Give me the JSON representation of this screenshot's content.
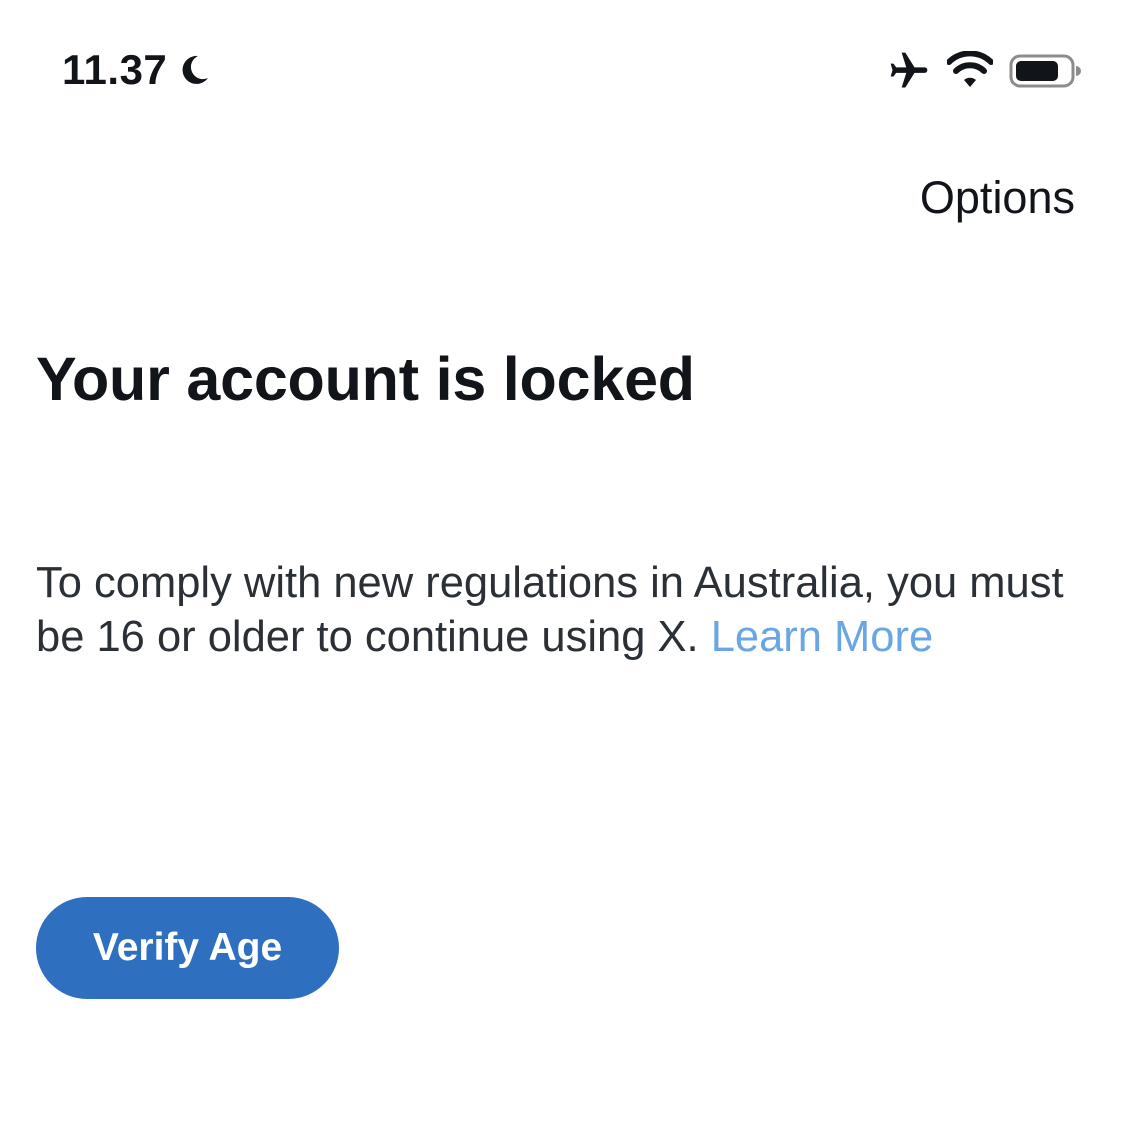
{
  "status_bar": {
    "time": "11.37",
    "focus_mode_icon": "moon-icon",
    "airplane_icon": "airplane-icon",
    "wifi_icon": "wifi-icon",
    "battery_icon": "battery-icon",
    "battery_level": 0.8
  },
  "header": {
    "options_label": "Options"
  },
  "main": {
    "title": "Your account is locked",
    "message": "To comply with new regulations in Australia, you must be 16 or older to continue using X.",
    "learn_more_label": "Learn More",
    "verify_button_label": "Verify Age"
  },
  "colors": {
    "link": "#6aa6e3",
    "primary_button": "#2f6fbf",
    "button_text": "#ffffff",
    "text": "#111418"
  }
}
